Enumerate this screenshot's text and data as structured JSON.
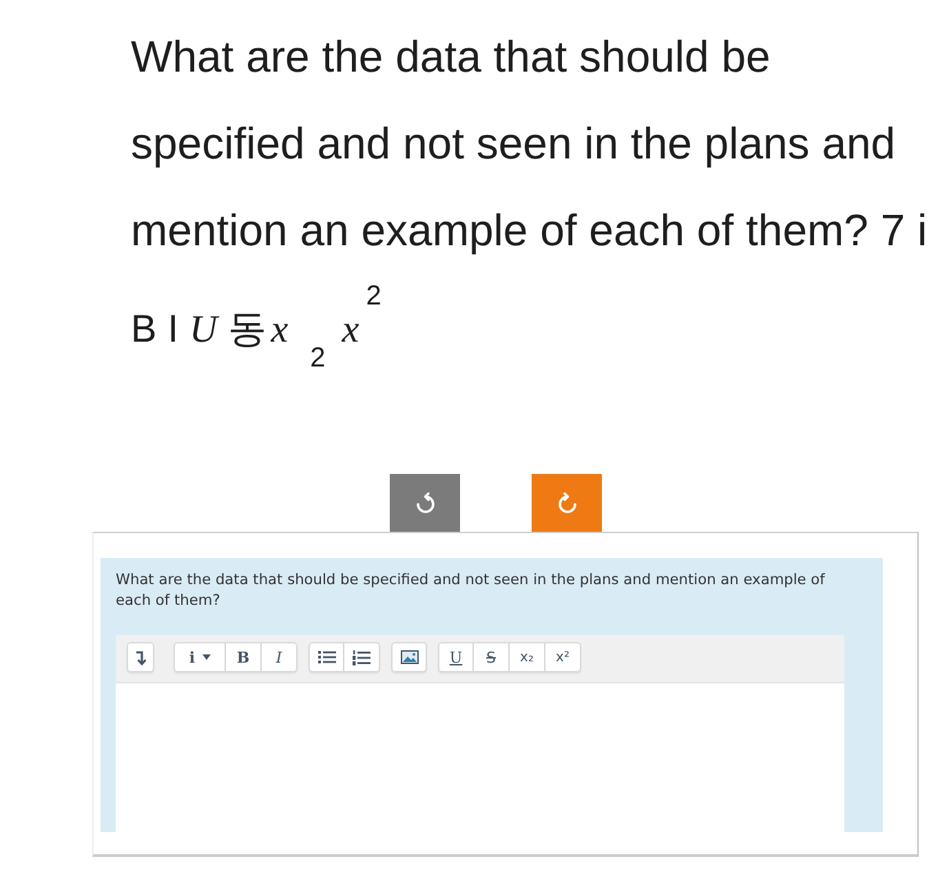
{
  "prompt": {
    "lines": [
      "What are the data that should be",
      "specified and not seen in the plans and",
      "mention an example of each of them? 7 i"
    ]
  },
  "format_row": [
    {
      "kind": "sans",
      "text": "B"
    },
    {
      "kind": "sans",
      "text": "I"
    },
    {
      "kind": "serif-italic",
      "text": "U"
    },
    {
      "kind": "sans",
      "text": "동"
    },
    {
      "kind": "subscript",
      "text": "x",
      "script": "2"
    },
    {
      "kind": "superscript",
      "text": "x",
      "script": "2"
    }
  ],
  "action_buttons": [
    {
      "kind": "undo",
      "disabled": true
    },
    {
      "kind": "redo",
      "disabled": false
    }
  ],
  "question_card": {
    "question": "What are the data that should be specified and not seen in the plans and mention an example of each of them?",
    "editor": {
      "toolbar": [
        {
          "items": [
            {
              "kind": "toggle"
            }
          ]
        },
        {
          "items": [
            {
              "kind": "style",
              "label": "i"
            },
            {
              "kind": "bold",
              "label": "B"
            },
            {
              "kind": "italic",
              "label": "I"
            }
          ]
        },
        {
          "items": [
            {
              "kind": "bullets"
            },
            {
              "kind": "numbered"
            }
          ]
        },
        {
          "items": [
            {
              "kind": "image"
            }
          ]
        },
        {
          "items": [
            {
              "kind": "underline",
              "label": "U"
            },
            {
              "kind": "strike",
              "label": "S"
            },
            {
              "kind": "subscript",
              "label": "x₂"
            },
            {
              "kind": "superscript",
              "label": "x²"
            }
          ]
        }
      ]
    }
  }
}
